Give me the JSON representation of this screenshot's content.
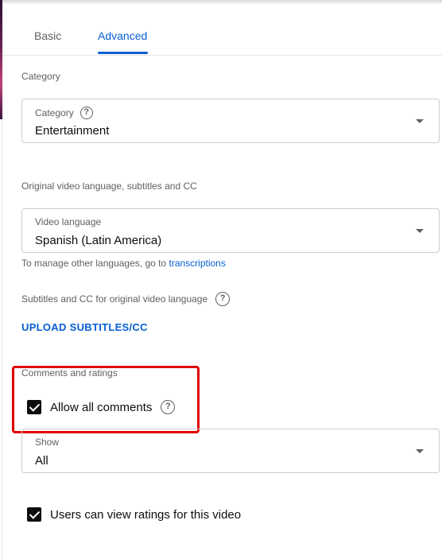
{
  "tabs": [
    {
      "label": "Basic"
    },
    {
      "label": "Advanced"
    }
  ],
  "category_section": {
    "heading": "Category",
    "select": {
      "label": "Category",
      "value": "Entertainment"
    }
  },
  "language_section": {
    "heading": "Original video language, subtitles and CC",
    "select": {
      "label": "Video language",
      "value": "Spanish (Latin America)"
    },
    "hint_text": "To manage other languages, go to",
    "hint_link": "transcriptions",
    "subtitles_label": "Subtitles and CC for original video language",
    "upload_button": "UPLOAD SUBTITLES/CC"
  },
  "comments_section": {
    "heading": "Comments and ratings",
    "allow_comments": {
      "label": "Allow all comments",
      "checked": true
    },
    "show_select": {
      "label": "Show",
      "value": "All"
    },
    "ratings": {
      "label": "Users can view ratings for this video",
      "checked": true
    }
  },
  "help_icon_glyph": "?",
  "colors": {
    "accent": "#065fd4",
    "highlight": "#e00000",
    "text_secondary": "#606060"
  }
}
